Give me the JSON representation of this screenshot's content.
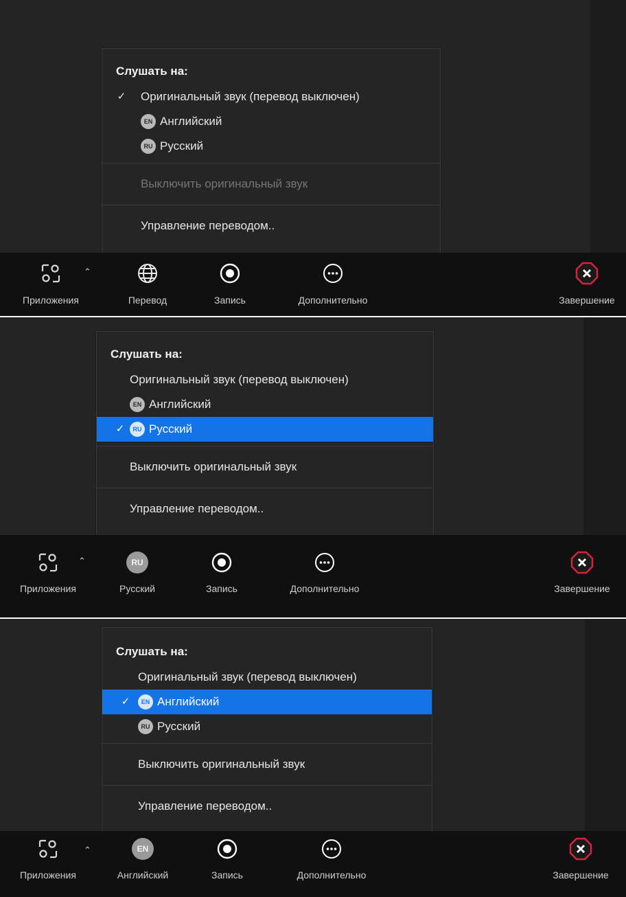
{
  "colors": {
    "panel_bg": "#242424",
    "menu_bg": "#252525",
    "selected_bg": "#1473e6",
    "toolbar_bg": "#101010",
    "end_icon": "#d0263c"
  },
  "panels": [
    {
      "menu": {
        "header": "Слушать на:",
        "original": {
          "label": "Оригинальный звук (перевод выключен)",
          "check": "✓"
        },
        "english": {
          "badge": "EN",
          "label": "Английский",
          "check": ""
        },
        "russian": {
          "badge": "RU",
          "label": "Русский",
          "check": ""
        },
        "mute_original": "Выключить оригинальный звук",
        "manage": "Управление переводом.."
      },
      "toolbar": {
        "apps": "Приложения",
        "translation": "Перевод",
        "record": "Запись",
        "more": "Дополнительно",
        "end": "Завершение"
      }
    },
    {
      "menu": {
        "header": "Слушать на:",
        "original": {
          "label": "Оригинальный звук (перевод выключен)",
          "check": ""
        },
        "english": {
          "badge": "EN",
          "label": "Английский",
          "check": ""
        },
        "russian": {
          "badge": "RU",
          "label": "Русский",
          "check": "✓"
        },
        "mute_original": "Выключить оригинальный звук",
        "manage": "Управление переводом.."
      },
      "toolbar": {
        "apps": "Приложения",
        "translation": "Русский",
        "translation_badge": "RU",
        "record": "Запись",
        "more": "Дополнительно",
        "end": "Завершение"
      }
    },
    {
      "menu": {
        "header": "Слушать на:",
        "original": {
          "label": "Оригинальный звук (перевод выключен)",
          "check": ""
        },
        "english": {
          "badge": "EN",
          "label": "Английский",
          "check": "✓"
        },
        "russian": {
          "badge": "RU",
          "label": "Русский",
          "check": ""
        },
        "mute_original": "Выключить оригинальный звук",
        "manage": "Управление переводом.."
      },
      "toolbar": {
        "apps": "Приложения",
        "translation": "Английский",
        "translation_badge": "EN",
        "record": "Запись",
        "more": "Дополнительно",
        "end": "Завершение"
      }
    }
  ]
}
